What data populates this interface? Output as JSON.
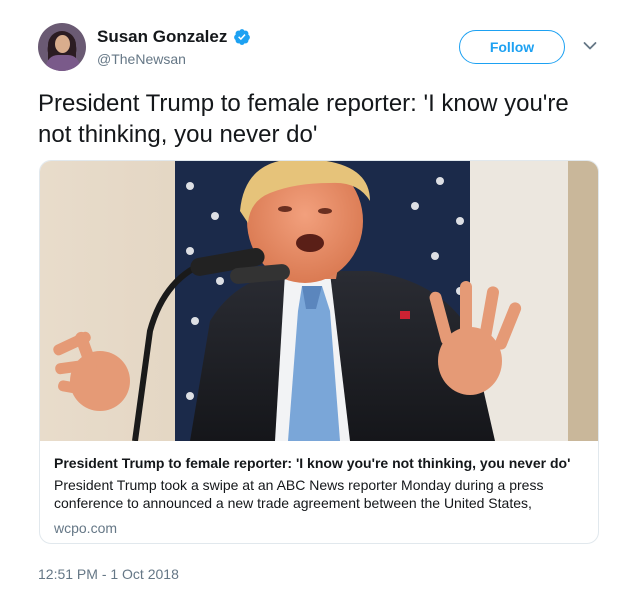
{
  "user": {
    "name": "Susan Gonzalez",
    "handle": "@TheNewsan",
    "verified": true
  },
  "follow_label": "Follow",
  "tweet_text": "President Trump to female reporter: 'I know you're not thinking, you never do'",
  "card": {
    "title": "President Trump to female reporter: 'I know you're not thinking, you never do'",
    "description": "President Trump took a swipe at an ABC News reporter Monday during a press conference to announced a new trade agreement between the United States,",
    "domain": "wcpo.com"
  },
  "timestamp": "12:51 PM - 1 Oct 2018",
  "colors": {
    "accent": "#1da1f2",
    "muted": "#657786",
    "text": "#14171a",
    "border": "#e1e8ed"
  }
}
